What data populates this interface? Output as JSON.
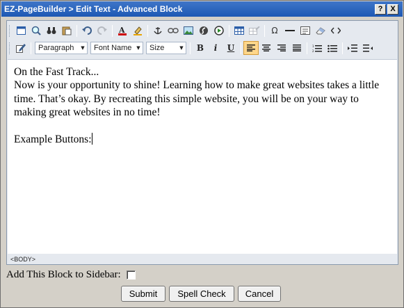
{
  "window": {
    "title": "EZ-PageBuilder > Edit Text - Advanced Block",
    "help_label": "?",
    "close_label": "X"
  },
  "toolbar": {
    "row1_icons": [
      "preview-icon",
      "zoom-icon",
      "find-icon",
      "paste-icon",
      "undo-icon",
      "redo-icon",
      "text-color-icon",
      "highlight-icon",
      "anchor-icon",
      "link-icon",
      "image-icon",
      "flash-icon",
      "media-icon",
      "table-icon",
      "table-properties-icon",
      "special-char-icon",
      "horizontal-rule-icon",
      "form-icon",
      "eraser-icon",
      "source-code-icon"
    ],
    "row2": {
      "format_value": "Paragraph",
      "font_value": "Font Name",
      "size_value": "Size",
      "bold_label": "B",
      "italic_label": "i",
      "underline_label": "U"
    }
  },
  "content": {
    "heading": "On the Fast Track...",
    "paragraph": "Now is your opportunity to shine!  Learning how to make great websites takes a little time.  That’s okay.  By recreating this simple website, you will be on your way to making great websites in no time!",
    "example_label": "Example Buttons:"
  },
  "status": {
    "path": "<BODY>"
  },
  "sidebar_option": {
    "label": "Add This Block to Sidebar:",
    "checked": false
  },
  "buttons": {
    "submit_label": "Submit",
    "spell_check_label": "Spell Check",
    "cancel_label": "Cancel"
  }
}
